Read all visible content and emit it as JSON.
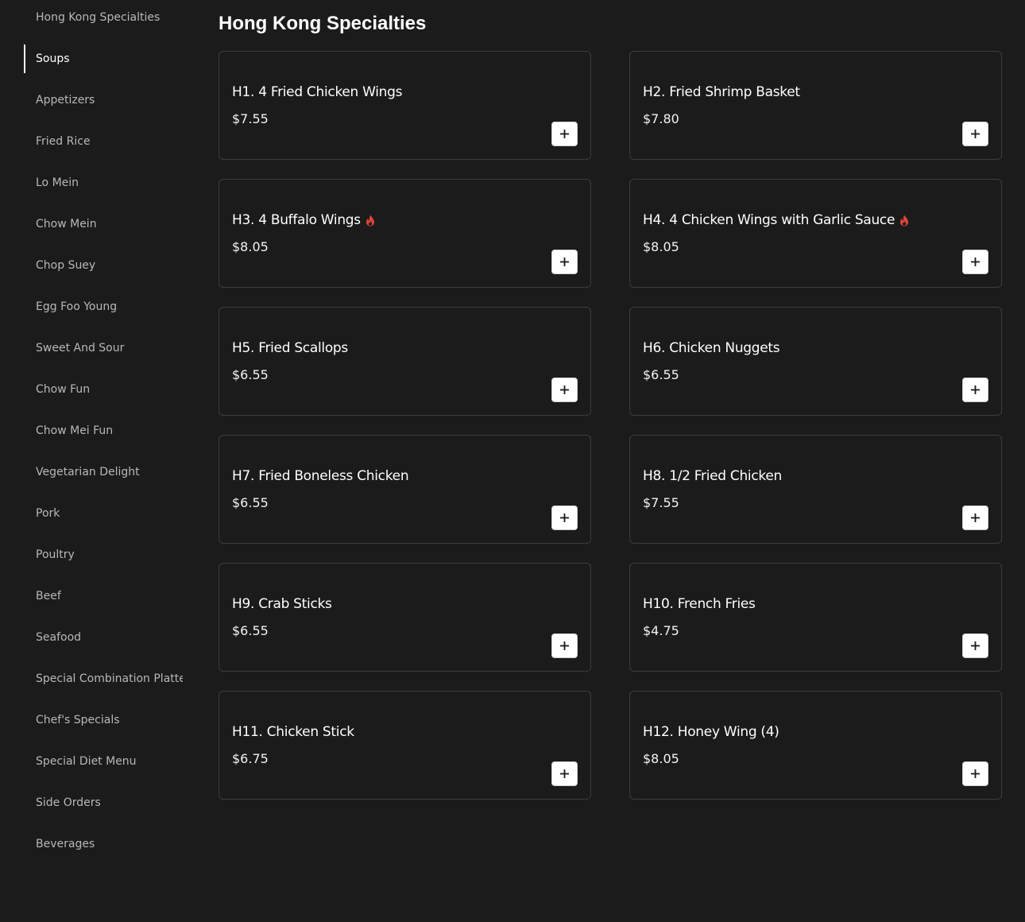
{
  "page_title": "Hong Kong Specialties",
  "sidebar": {
    "active_index": 1,
    "items": [
      "Hong Kong Specialties",
      "Soups",
      "Appetizers",
      "Fried Rice",
      "Lo Mein",
      "Chow Mein",
      "Chop Suey",
      "Egg Foo Young",
      "Sweet And Sour",
      "Chow Fun",
      "Chow Mei Fun",
      "Vegetarian Delight",
      "Pork",
      "Poultry",
      "Beef",
      "Seafood",
      "Special Combination Platters",
      "Chef's Specials",
      "Special Diet Menu",
      "Side Orders",
      "Beverages"
    ]
  },
  "items": [
    {
      "name": "H1. 4 Fried Chicken Wings",
      "price": "$7.55",
      "spicy": false
    },
    {
      "name": "H2. Fried Shrimp Basket",
      "price": "$7.80",
      "spicy": false
    },
    {
      "name": "H3. 4 Buffalo Wings",
      "price": "$8.05",
      "spicy": true
    },
    {
      "name": "H4. 4 Chicken Wings with Garlic Sauce",
      "price": "$8.05",
      "spicy": true
    },
    {
      "name": "H5. Fried Scallops",
      "price": "$6.55",
      "spicy": false
    },
    {
      "name": "H6. Chicken Nuggets",
      "price": "$6.55",
      "spicy": false
    },
    {
      "name": "H7. Fried Boneless Chicken",
      "price": "$6.55",
      "spicy": false
    },
    {
      "name": "H8. 1/2 Fried Chicken",
      "price": "$7.55",
      "spicy": false
    },
    {
      "name": "H9. Crab Sticks",
      "price": "$6.55",
      "spicy": false
    },
    {
      "name": "H10. French Fries",
      "price": "$4.75",
      "spicy": false
    },
    {
      "name": "H11. Chicken Stick",
      "price": "$6.75",
      "spicy": false
    },
    {
      "name": "H12. Honey Wing (4)",
      "price": "$8.05",
      "spicy": false
    }
  ],
  "icons": {
    "spicy": "flame-icon",
    "add": "plus-icon"
  },
  "colors": {
    "background": "#1b1b1b",
    "spicy": "#e0443a",
    "button": "#ffffff"
  }
}
